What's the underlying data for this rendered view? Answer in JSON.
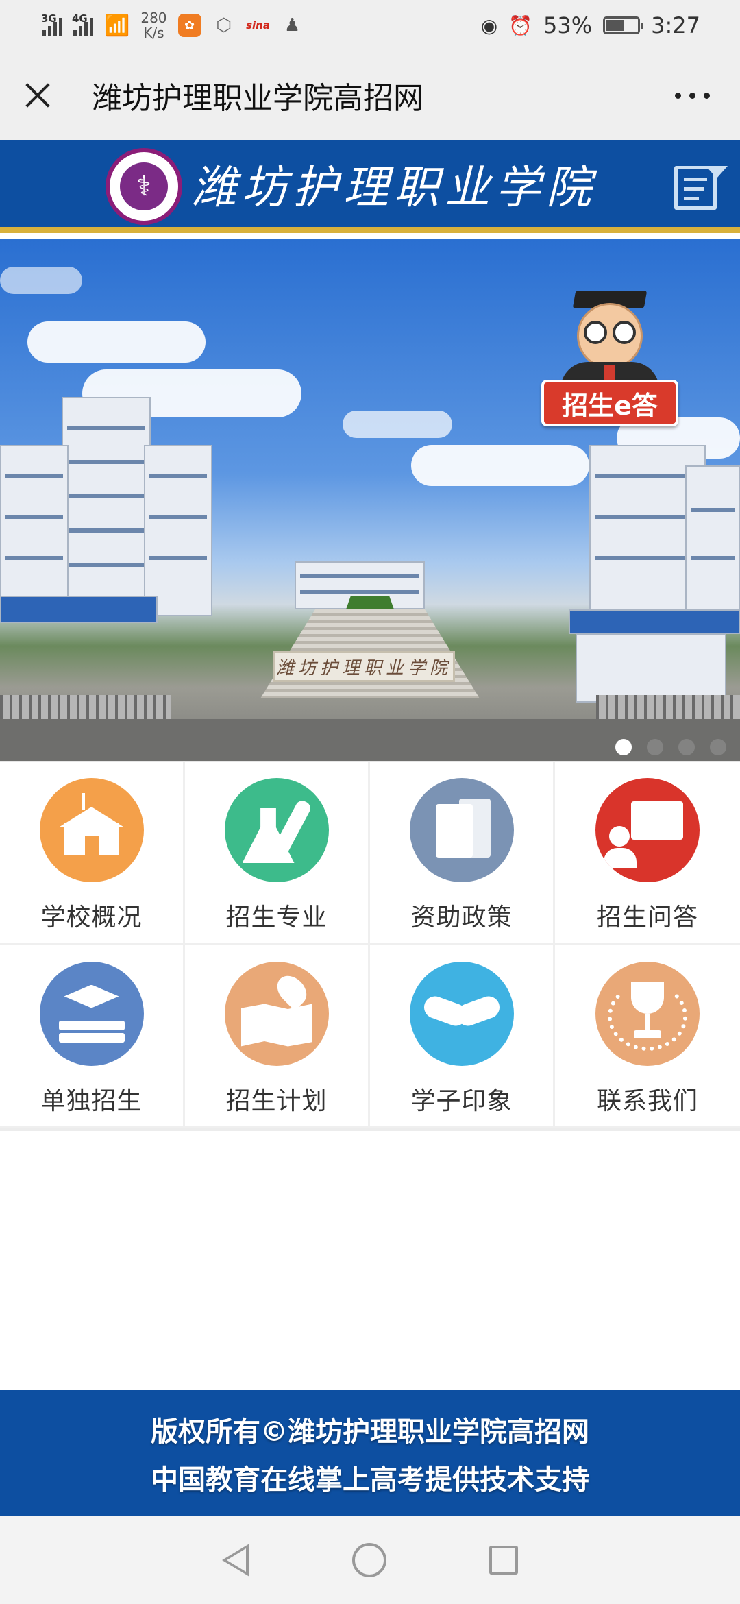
{
  "status": {
    "signal1": "3G",
    "signal2": "4G",
    "speed_value": "280",
    "speed_unit": "K/s",
    "battery": "53%",
    "time": "3:27",
    "app_icons": [
      "uc-browser-icon",
      "settings-hex-icon",
      "sina-icon",
      "qq-penguin-icon"
    ],
    "sina_label": "sina"
  },
  "titlebar": {
    "title": "潍坊护理职业学院高招网"
  },
  "header": {
    "school_name": "潍坊护理职业学院",
    "brand_color": "#0d4fa1",
    "accent_color": "#d8b13c"
  },
  "banner": {
    "gate_text": "潍坊护理职业学院",
    "mascot_badge": "招生e答",
    "slide_count": 4,
    "active_slide": 1
  },
  "menu": {
    "items": [
      {
        "label": "学校概况",
        "icon": "school-building-icon",
        "color": "#f4a04a"
      },
      {
        "label": "招生专业",
        "icon": "flask-icon",
        "color": "#3dbb8b"
      },
      {
        "label": "资助政策",
        "icon": "document-icon",
        "color": "#7b93b4"
      },
      {
        "label": "招生问答",
        "icon": "presenter-board-icon",
        "color": "#d9342b"
      },
      {
        "label": "单独招生",
        "icon": "graduation-book-icon",
        "color": "#5b85c6"
      },
      {
        "label": "招生计划",
        "icon": "map-pin-icon",
        "color": "#e9a877"
      },
      {
        "label": "学子印象",
        "icon": "handshake-icon",
        "color": "#3fb2e2"
      },
      {
        "label": "联系我们",
        "icon": "trophy-icon",
        "color": "#e9a877"
      }
    ]
  },
  "footer": {
    "line1": "版权所有©潍坊护理职业学院高招网",
    "line2": "中国教育在线掌上高考提供技术支持"
  }
}
